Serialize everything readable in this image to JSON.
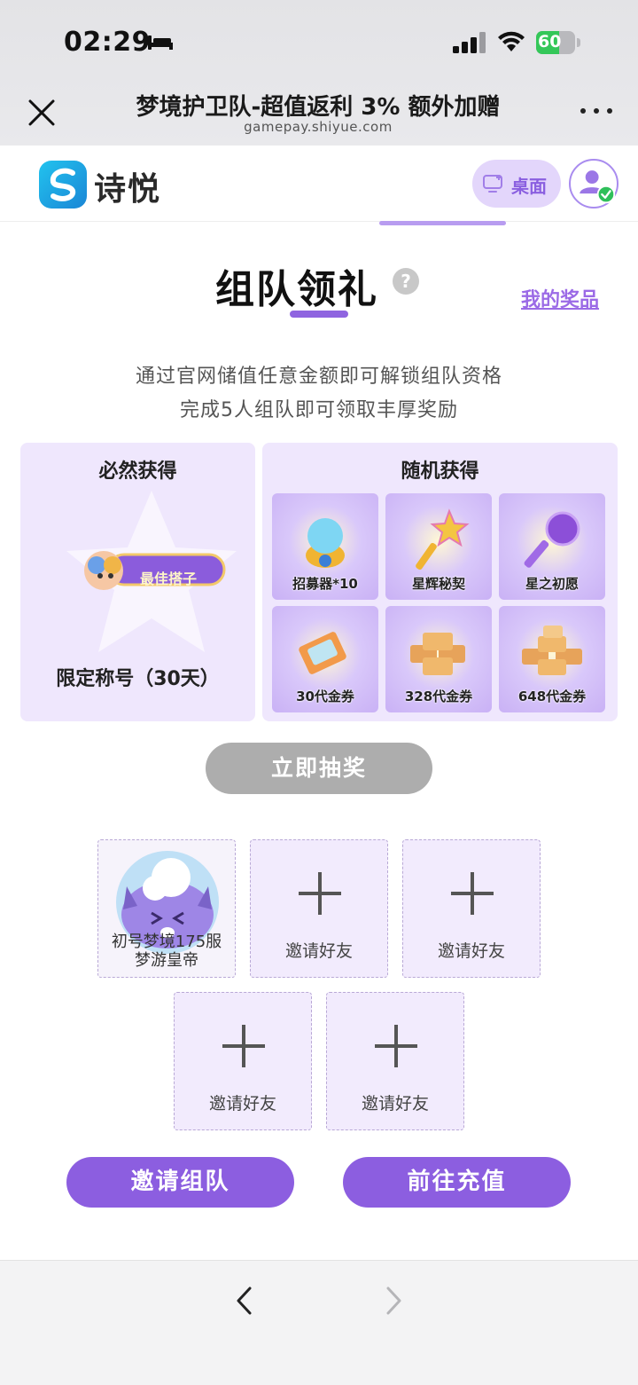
{
  "status_bar": {
    "time": "02:29",
    "battery_level": "60",
    "battery_fraction": 0.6
  },
  "browser": {
    "title": "梦境护卫队-超值返利 3% 额外加赠",
    "url": "gamepay.shiyue.com"
  },
  "header": {
    "logo_text": "诗悦",
    "desktop_label": "桌面"
  },
  "section": {
    "title": "组队领礼",
    "help_symbol": "?",
    "my_prizes": "我的奖品",
    "desc_line1": "通过官网储值任意金额即可解锁组队资格",
    "desc_line2": "完成5人组队即可领取丰厚奖励"
  },
  "guaranteed": {
    "title": "必然获得",
    "badge_text": "最佳搭子",
    "reward_name": "限定称号（30天）"
  },
  "random": {
    "title": "随机获得",
    "items": [
      {
        "label": "招募器*10"
      },
      {
        "label": "星辉秘契"
      },
      {
        "label": "星之初愿"
      },
      {
        "label": "30代金券"
      },
      {
        "label": "328代金券"
      },
      {
        "label": "648代金券"
      }
    ]
  },
  "draw_button": "立即抽奖",
  "team": {
    "member": {
      "line1": "初号梦境175服",
      "line2": "梦游皇帝"
    },
    "invite_label": "邀请好友"
  },
  "actions": {
    "invite_team": "邀请组队",
    "recharge": "前往充值"
  },
  "colors": {
    "accent": "#8c5ee0",
    "panel_bg": "#efe7fd",
    "disabled": "#adadad"
  }
}
